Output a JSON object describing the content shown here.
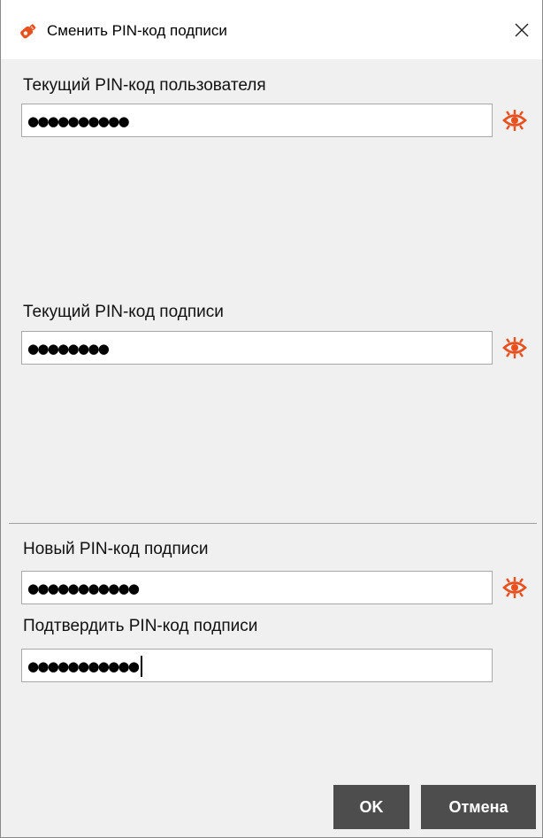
{
  "window": {
    "title": "Сменить PIN-код подписи",
    "icon": "usb-token-icon",
    "close_icon": "close-icon"
  },
  "fields": [
    {
      "label": "Текущий PIN-код пользователя",
      "value_masked": "●●●●●●●●●●",
      "has_toggle": true
    },
    {
      "label": "Текущий PIN-код подписи",
      "value_masked": "●●●●●●●●",
      "has_toggle": true
    },
    {
      "label": "Новый PIN-код подписи",
      "value_masked": "●●●●●●●●●●●",
      "has_toggle": true
    },
    {
      "label": "Подтвердить PIN-код подписи",
      "value_masked": "●●●●●●●●●●●",
      "has_toggle": false,
      "focused": true
    }
  ],
  "buttons": {
    "ok": "OK",
    "cancel": "Отмена"
  },
  "colors": {
    "accent": "#e8501e",
    "button_bg": "#4d4d4d",
    "dialog_bg": "#f0f0f0"
  }
}
